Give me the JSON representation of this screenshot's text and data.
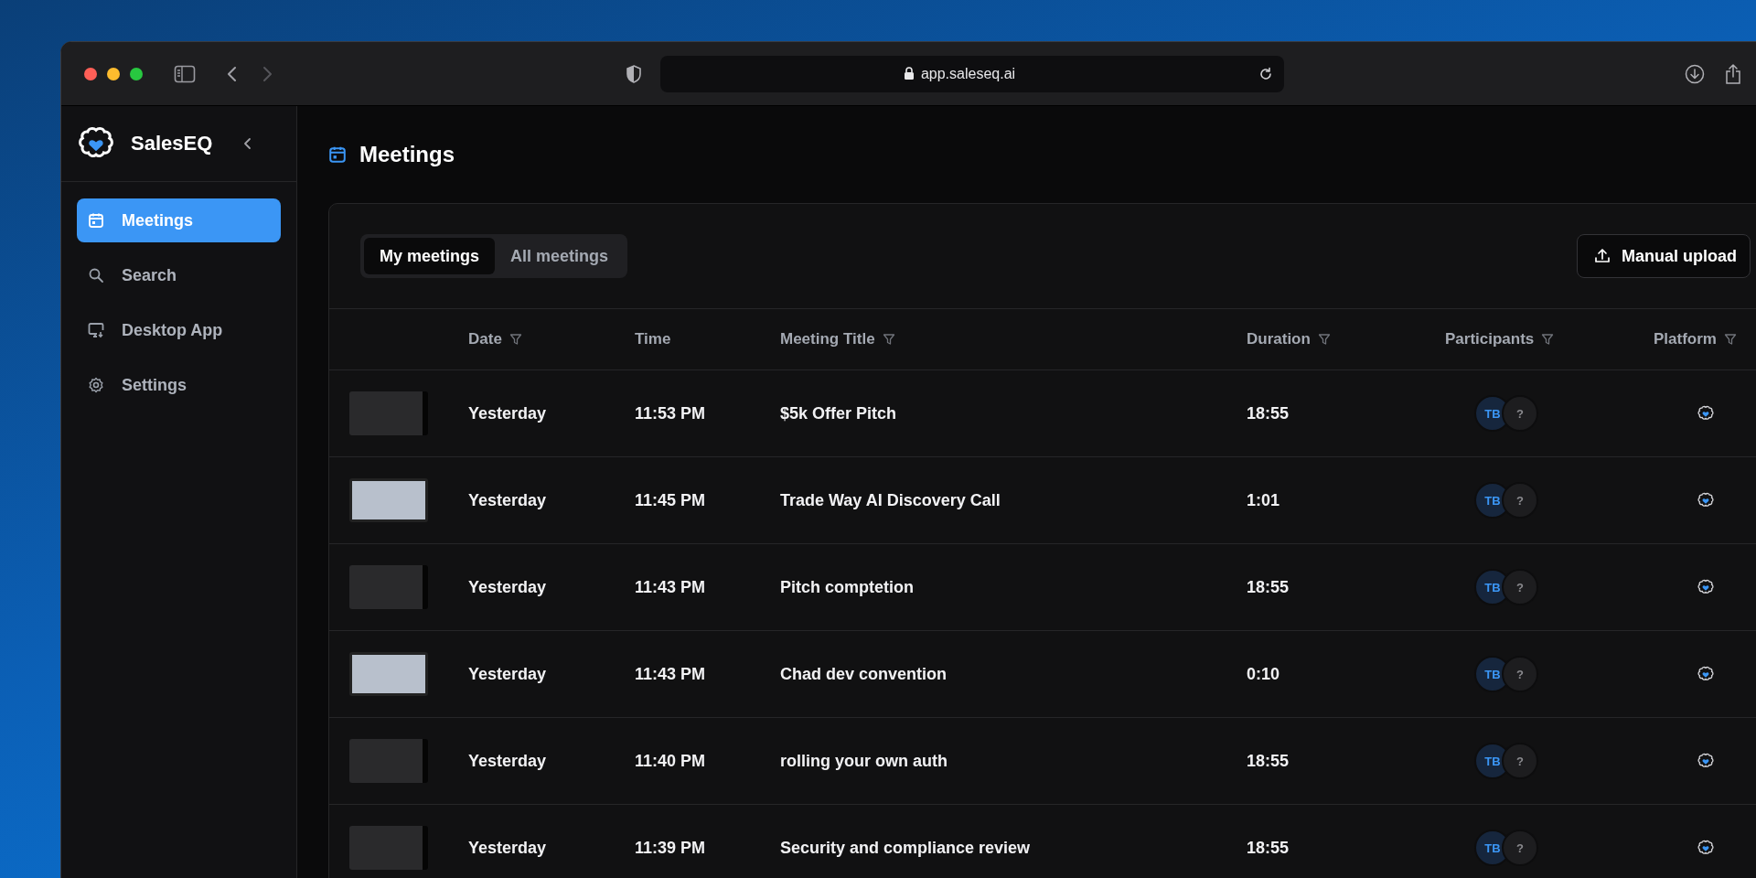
{
  "browser": {
    "url": "app.saleseq.ai"
  },
  "sidebar": {
    "brand": "SalesEQ",
    "items": [
      {
        "label": "Meetings",
        "selected": true
      },
      {
        "label": "Search",
        "selected": false
      },
      {
        "label": "Desktop App",
        "selected": false
      },
      {
        "label": "Settings",
        "selected": false
      }
    ]
  },
  "page": {
    "title": "Meetings"
  },
  "view_tabs": [
    {
      "label": "My meetings",
      "selected": true
    },
    {
      "label": "All meetings",
      "selected": false
    }
  ],
  "upload_button": {
    "label": "Manual upload"
  },
  "table": {
    "columns": [
      {
        "label": "Date",
        "filter": true
      },
      {
        "label": "Time",
        "filter": false
      },
      {
        "label": "Meeting Title",
        "filter": true
      },
      {
        "label": "Duration",
        "filter": true
      },
      {
        "label": "Participants",
        "filter": true
      },
      {
        "label": "Platform",
        "filter": true
      }
    ],
    "rows": [
      {
        "kind": "screen",
        "date": "Yesterday",
        "time": "11:53 PM",
        "title": "$5k Offer Pitch",
        "duration": "18:55",
        "participants": [
          "TB",
          "?"
        ]
      },
      {
        "kind": "video",
        "date": "Yesterday",
        "time": "11:45 PM",
        "title": "Trade Way AI Discovery Call",
        "duration": "1:01",
        "participants": [
          "TB",
          "?"
        ]
      },
      {
        "kind": "screen",
        "date": "Yesterday",
        "time": "11:43 PM",
        "title": "Pitch comptetion",
        "duration": "18:55",
        "participants": [
          "TB",
          "?"
        ]
      },
      {
        "kind": "video",
        "date": "Yesterday",
        "time": "11:43 PM",
        "title": "Chad dev convention",
        "duration": "0:10",
        "participants": [
          "TB",
          "?"
        ]
      },
      {
        "kind": "screen",
        "date": "Yesterday",
        "time": "11:40 PM",
        "title": "rolling your own auth",
        "duration": "18:55",
        "participants": [
          "TB",
          "?"
        ]
      },
      {
        "kind": "screen",
        "date": "Yesterday",
        "time": "11:39 PM",
        "title": "Security and compliance review",
        "duration": "18:55",
        "participants": [
          "TB",
          "?"
        ]
      }
    ]
  }
}
